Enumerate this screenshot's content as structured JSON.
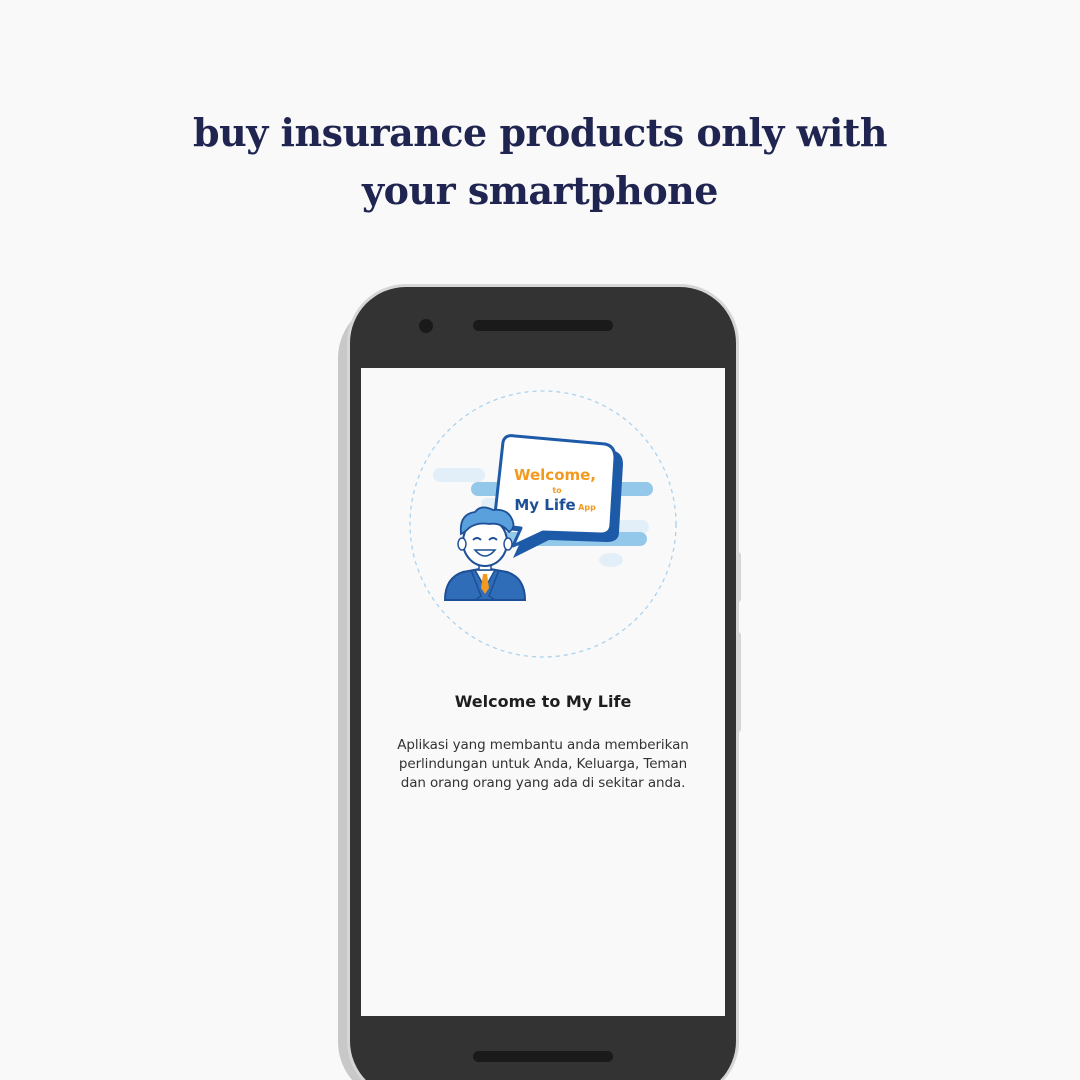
{
  "headline": {
    "line1": "buy insurance products only with",
    "line2": "your smartphone"
  },
  "illustration": {
    "bubble_line1": "Welcome,",
    "bubble_line2": "to",
    "bubble_line3": "My Life",
    "bubble_app": "App"
  },
  "screen": {
    "title": "Welcome to My Life",
    "description_lines": [
      "Aplikasi yang membantu anda memberikan",
      "perlindungan untuk Anda, Keluarga, Teman",
      "dan orang orang yang ada di sekitar anda."
    ]
  },
  "colors": {
    "headline": "#1f2550",
    "phone_body": "#333333",
    "accent_orange": "#f39a1e",
    "accent_blue": "#1d5aa8"
  }
}
